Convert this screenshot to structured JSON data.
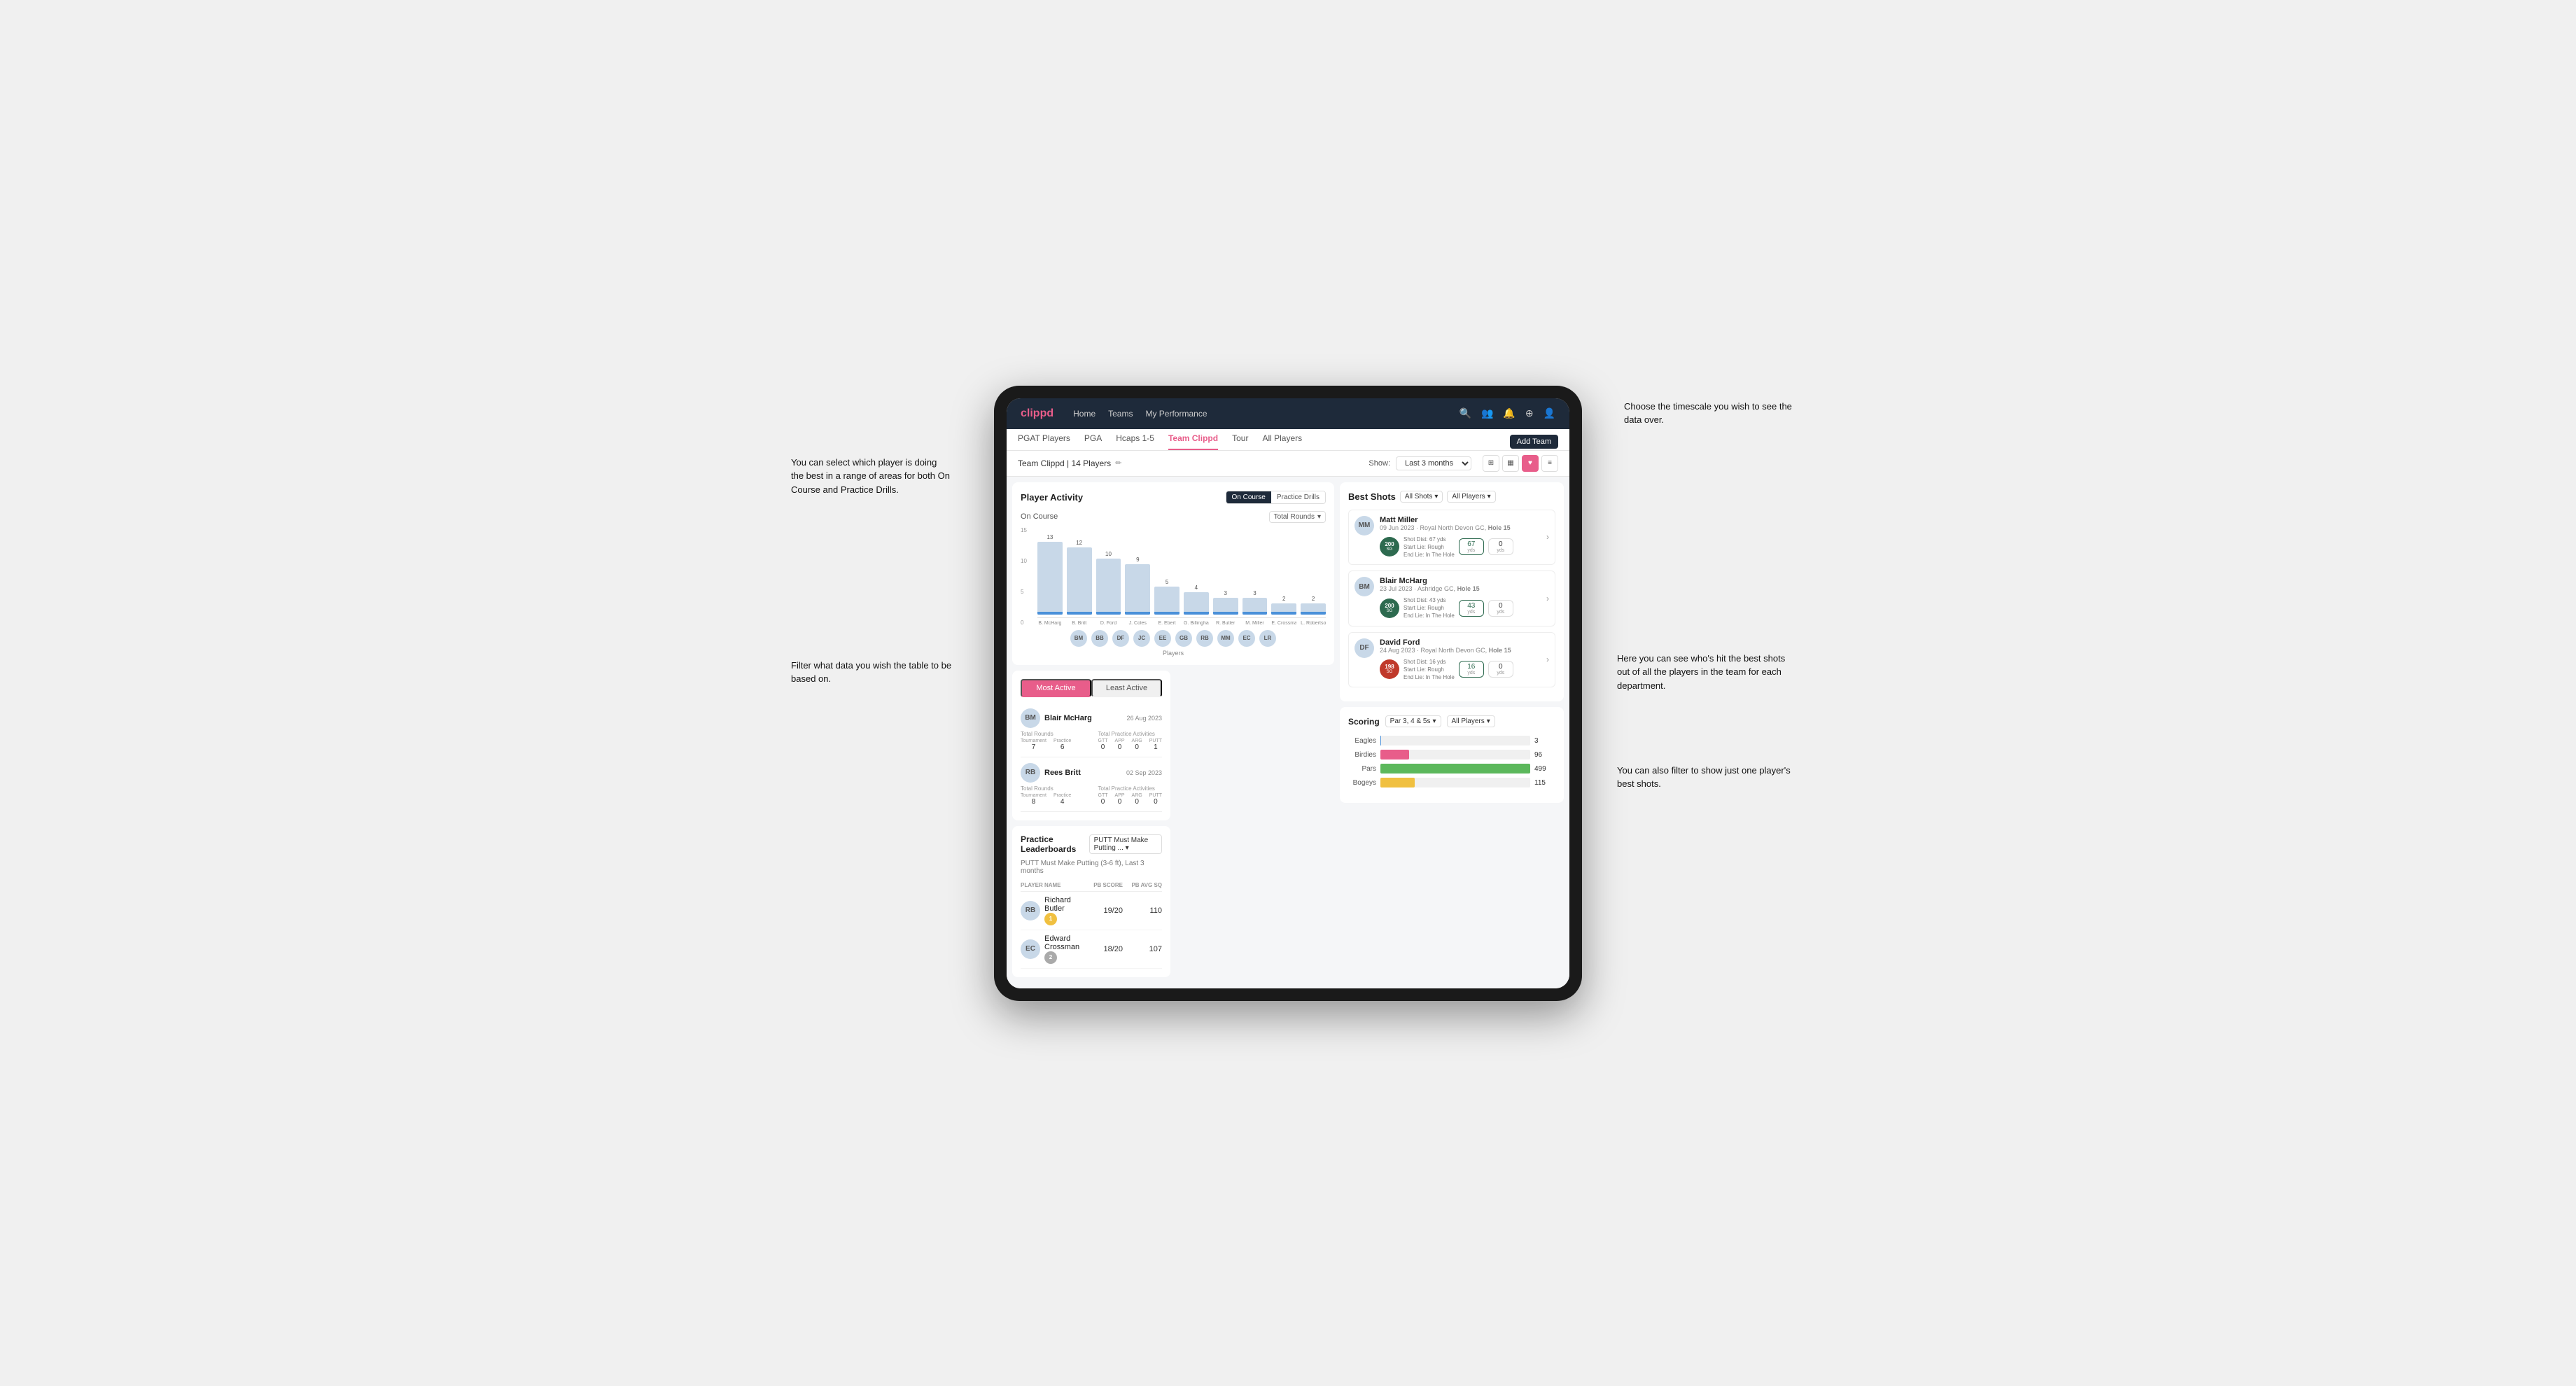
{
  "annotations": {
    "top_right": "Choose the timescale you wish to see the data over.",
    "left_top": "You can select which player is doing the best in a range of areas for both On Course and Practice Drills.",
    "left_bottom": "Filter what data you wish the table to be based on.",
    "right_mid": "Here you can see who's hit the best shots out of all the players in the team for each department.",
    "right_bottom": "You can also filter to show just one player's best shots."
  },
  "nav": {
    "logo": "clippd",
    "links": [
      "Home",
      "Teams",
      "My Performance"
    ],
    "icons": [
      "search",
      "people",
      "bell",
      "add-circle",
      "avatar"
    ]
  },
  "tabs": {
    "items": [
      "PGAT Players",
      "PGA",
      "Hcaps 1-5",
      "Team Clippd",
      "Tour",
      "All Players"
    ],
    "active": "Team Clippd",
    "add_btn": "Add Team"
  },
  "toolbar": {
    "team_label": "Team Clippd | 14 Players",
    "show_label": "Show:",
    "period": "Last 3 months",
    "view_icons": [
      "grid",
      "cards",
      "heart",
      "list"
    ]
  },
  "player_activity": {
    "title": "Player Activity",
    "toggle_on_course": "On Course",
    "toggle_practice": "Practice Drills",
    "chart_subtitle": "On Course",
    "chart_filter": "Total Rounds",
    "y_axis": [
      "15",
      "10",
      "5",
      "0"
    ],
    "players": [
      {
        "name": "B. McHarg",
        "value": 13
      },
      {
        "name": "B. Britt",
        "value": 12
      },
      {
        "name": "D. Ford",
        "value": 10
      },
      {
        "name": "J. Coles",
        "value": 9
      },
      {
        "name": "E. Ebert",
        "value": 5
      },
      {
        "name": "G. Billingham",
        "value": 4
      },
      {
        "name": "R. Butler",
        "value": 3
      },
      {
        "name": "M. Miller",
        "value": 3
      },
      {
        "name": "E. Crossman",
        "value": 2
      },
      {
        "name": "L. Robertson",
        "value": 2
      }
    ],
    "x_label": "Players"
  },
  "best_shots": {
    "title": "Best Shots",
    "filter1": "All Shots",
    "filter2": "All Players",
    "players": [
      {
        "name": "Matt Miller",
        "date": "09 Jun 2023",
        "course": "Royal North Devon GC",
        "hole": "Hole 15",
        "badge_value": "200",
        "badge_label": "SG",
        "badge_color": "green",
        "shot_dist": "67 yds",
        "start_lie": "Rough",
        "end_lie": "In The Hole",
        "stat1": "67",
        "stat1_unit": "yds",
        "stat2": "0",
        "stat2_unit": "yds"
      },
      {
        "name": "Blair McHarg",
        "date": "23 Jul 2023",
        "course": "Ashridge GC",
        "hole": "Hole 15",
        "badge_value": "200",
        "badge_label": "SG",
        "badge_color": "green",
        "shot_dist": "43 yds",
        "start_lie": "Rough",
        "end_lie": "In The Hole",
        "stat1": "43",
        "stat1_unit": "yds",
        "stat2": "0",
        "stat2_unit": "yds"
      },
      {
        "name": "David Ford",
        "date": "24 Aug 2023",
        "course": "Royal North Devon GC",
        "hole": "Hole 15",
        "badge_value": "198",
        "badge_label": "SG",
        "badge_color": "red",
        "shot_dist": "16 yds",
        "start_lie": "Rough",
        "end_lie": "In The Hole",
        "stat1": "16",
        "stat1_unit": "yds",
        "stat2": "0",
        "stat2_unit": "yds"
      }
    ]
  },
  "practice_leaderboards": {
    "title": "Practice Leaderboards",
    "filter": "PUTT Must Make Putting ...",
    "subtitle": "PUTT Must Make Putting (3-6 ft), Last 3 months",
    "columns": [
      "PLAYER NAME",
      "PB SCORE",
      "PB AVG SQ"
    ],
    "players": [
      {
        "rank": "1",
        "name": "Richard Butler",
        "pb_score": "19/20",
        "pb_avg": "110"
      },
      {
        "rank": "2",
        "name": "Edward Crossman",
        "pb_score": "18/20",
        "pb_avg": "107"
      }
    ]
  },
  "most_active": {
    "tabs": [
      "Most Active",
      "Least Active"
    ],
    "active_tab": "Most Active",
    "players": [
      {
        "name": "Blair McHarg",
        "date": "26 Aug 2023",
        "total_rounds_label": "Total Rounds",
        "tournament": "7",
        "practice": "6",
        "total_practice_label": "Total Practice Activities",
        "gtt": "0",
        "app": "0",
        "arg": "0",
        "putt": "1"
      },
      {
        "name": "Rees Britt",
        "date": "02 Sep 2023",
        "total_rounds_label": "Total Rounds",
        "tournament": "8",
        "practice": "4",
        "total_practice_label": "Total Practice Activities",
        "gtt": "0",
        "app": "0",
        "arg": "0",
        "putt": "0"
      }
    ]
  },
  "scoring": {
    "title": "Scoring",
    "filter1": "Par 3, 4 & 5s",
    "filter2": "All Players",
    "rows": [
      {
        "label": "Eagles",
        "value": 3,
        "max": 500,
        "color": "eagles"
      },
      {
        "label": "Birdies",
        "value": 96,
        "max": 500,
        "color": "birdies"
      },
      {
        "label": "Pars",
        "value": 499,
        "max": 500,
        "color": "pars"
      },
      {
        "label": "Bogeys",
        "value": 115,
        "max": 500,
        "color": "bogeys"
      }
    ]
  }
}
